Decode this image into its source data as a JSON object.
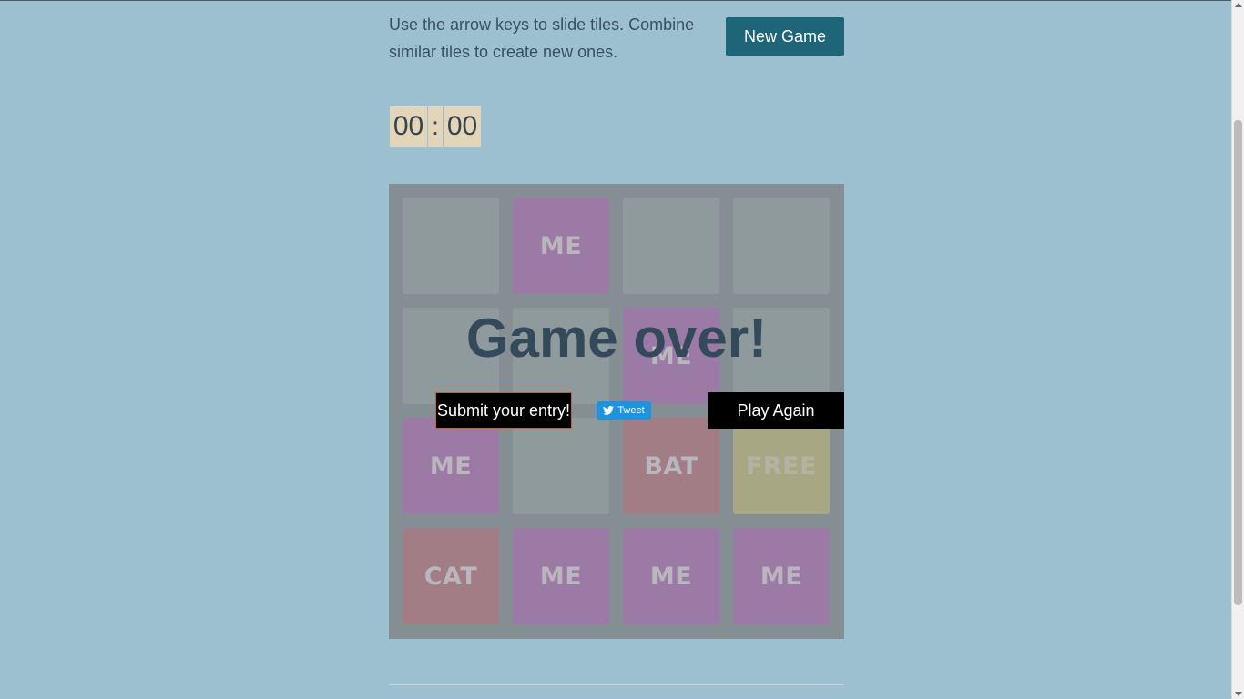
{
  "intro": {
    "text": "Use the arrow keys to slide tiles. Combine similar tiles to create new ones.",
    "new_game_label": "New Game"
  },
  "timer": {
    "minutes": "00",
    "separator": ":",
    "seconds": "00"
  },
  "board": {
    "rows": [
      [
        "",
        "ME",
        "",
        ""
      ],
      [
        "",
        "",
        "ME",
        ""
      ],
      [
        "ME",
        "",
        "BAT",
        "FREE"
      ],
      [
        "CAT",
        "ME",
        "ME",
        "ME"
      ]
    ]
  },
  "overlay": {
    "message": "Game over!",
    "submit_label": "Submit your entry!",
    "tweet_label": "Tweet",
    "play_again_label": "Play Again"
  },
  "colors": {
    "background": "#9cc0d0",
    "accent_button": "#1e6577",
    "tile_me": "#9c7aa6",
    "tile_bat": "#a27d86",
    "tile_cat": "#a27d86",
    "tile_free": "#a8a784",
    "tweet_blue": "#1b95e0"
  }
}
